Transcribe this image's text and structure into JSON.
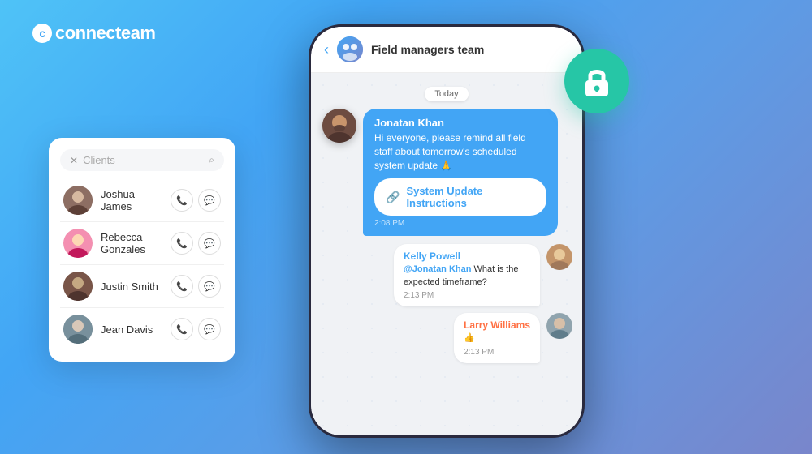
{
  "logo": {
    "text": "connecteam",
    "c_symbol": "c"
  },
  "contact_panel": {
    "search_placeholder": "Clients",
    "contacts": [
      {
        "id": 1,
        "name": "Joshua James",
        "avatar_emoji": "👤"
      },
      {
        "id": 2,
        "name": "Rebecca Gonzales",
        "avatar_emoji": "👤"
      },
      {
        "id": 3,
        "name": "Justin Smith",
        "avatar_emoji": "👤"
      },
      {
        "id": 4,
        "name": "Jean Davis",
        "avatar_emoji": "👤"
      }
    ]
  },
  "chat": {
    "team_name": "Field managers team",
    "date_label": "Today",
    "back_arrow": "‹",
    "messages": [
      {
        "id": "m1",
        "type": "sent",
        "sender": "Jonatan Khan",
        "text": "Hi everyone, please remind all field staff about tomorrow's scheduled system update 🙏",
        "link_label": "System Update Instructions",
        "time": "2:08 PM"
      },
      {
        "id": "m2",
        "type": "received",
        "sender": "Kelly Powell",
        "mention": "@Jonatan Khan",
        "text": "What is the expected timeframe?",
        "time": "2:13 PM"
      },
      {
        "id": "m3",
        "type": "received",
        "sender": "Larry Williams",
        "text": "👍",
        "time": "2:13 PM"
      }
    ]
  },
  "lock_badge": {
    "icon": "🔒"
  }
}
